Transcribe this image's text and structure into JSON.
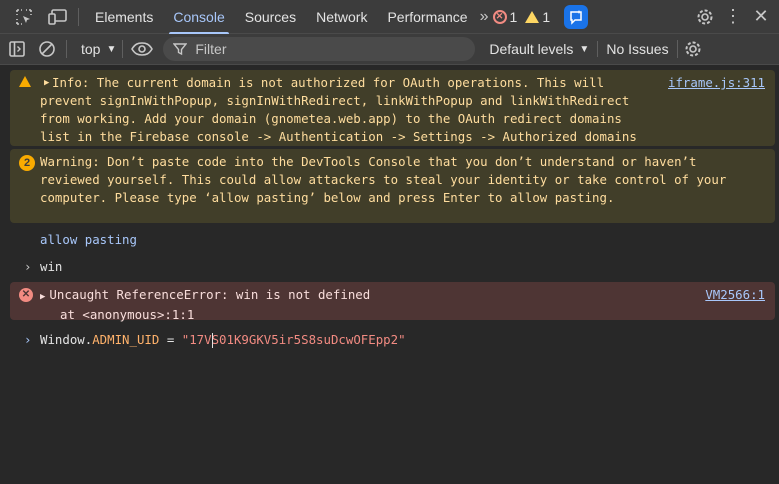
{
  "tabs": [
    {
      "label": "Elements"
    },
    {
      "label": "Console"
    },
    {
      "label": "Sources"
    },
    {
      "label": "Network"
    },
    {
      "label": "Performance"
    }
  ],
  "counts": {
    "errors": "1",
    "warnings": "1"
  },
  "toolbar": {
    "context": "top",
    "filter_placeholder": "Filter",
    "levels": "Default levels",
    "issues": "No Issues"
  },
  "messages": {
    "info_text": "Info: The current domain is not authorized for OAuth operations. This will prevent signInWithPopup, signInWithRedirect, linkWithPopup and linkWithRedirect from working. Add your domain (gnometea.web.app) to the OAuth redirect domains list in the Firebase console -> Authentication -> Settings -> Authorized domains tab.",
    "info_source": "iframe.js:311",
    "warning_count": "2",
    "warning_text": "Warning: Don’t paste code into the DevTools Console that you don’t understand or haven’t reviewed yourself. This could allow attackers to steal your identity or take control of your computer. Please type ‘allow pasting’ below and press Enter to allow pasting.",
    "echo_text": "allow pasting",
    "input_1": "win",
    "error_text": "Uncaught ReferenceError: win is not defined",
    "error_stack": "at <anonymous>:1:1",
    "error_source": "VM2566:1",
    "current_obj": "Window.",
    "current_prop": "ADMIN_UID",
    "current_eq": " = ",
    "current_string": "\"17VS01K9GKV5ir5S8suDcwOFEpp2\""
  },
  "colors": {
    "accent": "#a8c7fa",
    "warning_bg": "#413e29",
    "error_bg": "#4e3534"
  }
}
